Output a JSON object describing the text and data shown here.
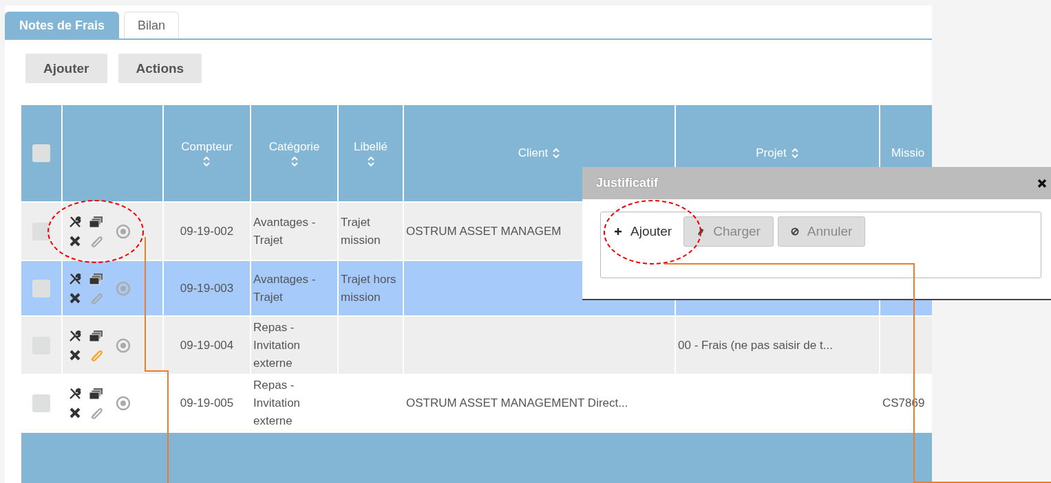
{
  "tabs": [
    {
      "label": "Notes de Frais",
      "selected": true
    },
    {
      "label": "Bilan",
      "selected": false
    }
  ],
  "toolbar": {
    "buttons": [
      "Ajouter",
      "Actions"
    ]
  },
  "table": {
    "select_all": {
      "checked": false
    },
    "columns": [
      {
        "label": "Compteur",
        "sortable": true
      },
      {
        "label": "Catégorie",
        "sortable": true
      },
      {
        "label": "Libellé",
        "sortable": true
      },
      {
        "label": "Client",
        "sortable": true
      },
      {
        "label": "Projet",
        "sortable": true
      },
      {
        "label": "Missio",
        "sortable": false
      }
    ],
    "rows": [
      {
        "checked": false,
        "selected": false,
        "attached": false,
        "cells": [
          "09-19-002",
          "Avantages - Trajet",
          "Trajet mission",
          "OSTRUM ASSET MANAGEM",
          null,
          null
        ]
      },
      {
        "checked": false,
        "selected": true,
        "attached": false,
        "cells": [
          "09-19-003",
          "Avantages - Trajet",
          "Trajet hors mission",
          null,
          null,
          null
        ]
      },
      {
        "checked": false,
        "selected": false,
        "attached": true,
        "cells": [
          "09-19-004",
          "Repas - Invitation externe",
          null,
          null,
          "00 - Frais (ne pas saisir de t...",
          null
        ]
      },
      {
        "checked": false,
        "selected": false,
        "attached": false,
        "cells": [
          "09-19-005",
          "Repas - Invitation externe",
          null,
          "OSTRUM ASSET MANAGEMENT Direct...",
          null,
          "CS7869"
        ]
      }
    ]
  },
  "dialog": {
    "title": "Justificatif",
    "buttons": [
      {
        "label": "Ajouter",
        "kind": "add",
        "disabled": false
      },
      {
        "label": "Charger",
        "kind": "upload",
        "disabled": true
      },
      {
        "label": "Annuler",
        "kind": "cancel",
        "disabled": true
      }
    ]
  },
  "annotations": [
    {
      "kind": "ellipse"
    },
    {
      "kind": "ellipse"
    },
    {
      "kind": "leader"
    },
    {
      "kind": "leader"
    }
  ]
}
